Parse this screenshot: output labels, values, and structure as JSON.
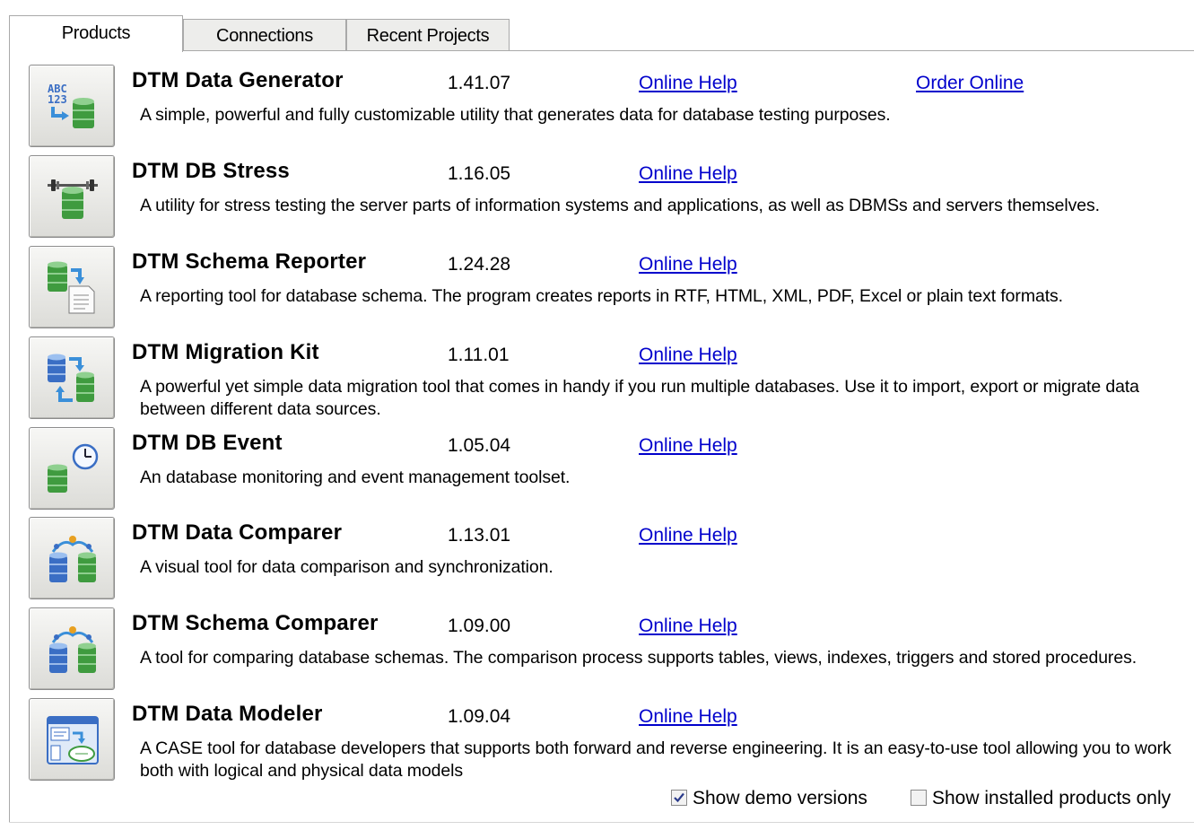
{
  "tabs": [
    {
      "label": "Products",
      "active": true
    },
    {
      "label": "Connections",
      "active": false
    },
    {
      "label": "Recent Projects",
      "active": false
    }
  ],
  "products": [
    {
      "name": "DTM Data Generator",
      "version": "1.41.07",
      "help": "Online Help",
      "order": "Order Online",
      "description": "A simple, powerful and fully customizable utility that generates data for database testing purposes.",
      "icon": "data-generator-icon"
    },
    {
      "name": "DTM DB Stress",
      "version": "1.16.05",
      "help": "Online Help",
      "description": "A utility for stress testing the server parts of information systems and applications, as well as DBMSs and servers themselves.",
      "icon": "db-stress-icon"
    },
    {
      "name": "DTM Schema Reporter",
      "version": "1.24.28",
      "help": "Online Help",
      "description": "A reporting tool for database schema. The program creates reports in RTF, HTML, XML, PDF, Excel or plain text formats.",
      "icon": "schema-reporter-icon"
    },
    {
      "name": "DTM Migration Kit",
      "version": "1.11.01",
      "help": "Online Help",
      "description": "A powerful yet simple data migration tool that comes in handy if you run multiple databases. Use it to import, export or migrate data between different data sources.",
      "icon": "migration-kit-icon"
    },
    {
      "name": "DTM DB Event",
      "version": "1.05.04",
      "help": "Online Help",
      "description": "An database monitoring and event management toolset.",
      "icon": "db-event-icon"
    },
    {
      "name": "DTM Data Comparer",
      "version": "1.13.01",
      "help": "Online Help",
      "description": "A visual tool for data comparison and synchronization.",
      "icon": "data-comparer-icon"
    },
    {
      "name": "DTM Schema Comparer",
      "version": "1.09.00",
      "help": "Online Help",
      "description": "A tool for comparing database schemas. The comparison process supports tables, views, indexes, triggers and stored procedures.",
      "icon": "schema-comparer-icon"
    },
    {
      "name": "DTM Data Modeler",
      "version": "1.09.04",
      "help": "Online Help",
      "description": "A CASE tool for database developers that supports both forward and reverse engineering. It is an easy-to-use tool allowing you to work both with logical and physical data models",
      "icon": "data-modeler-icon"
    }
  ],
  "options": {
    "show_demo": {
      "label": "Show demo versions",
      "checked": true
    },
    "show_installed": {
      "label": "Show installed products only",
      "checked": false
    }
  },
  "colors": {
    "link": "#0000cc",
    "db_green": "#3f9b3f",
    "db_blue": "#3a6ec4"
  }
}
